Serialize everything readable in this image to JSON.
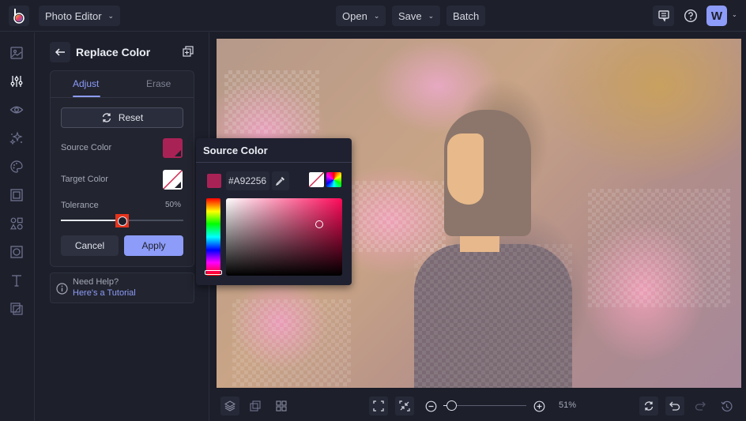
{
  "topbar": {
    "app_menu_label": "Photo Editor",
    "open_label": "Open",
    "save_label": "Save",
    "batch_label": "Batch",
    "avatar_initial": "W"
  },
  "rail": {
    "items": [
      {
        "name": "image",
        "active": false
      },
      {
        "name": "adjustments",
        "active": true
      },
      {
        "name": "eye",
        "active": false
      },
      {
        "name": "effects",
        "active": false
      },
      {
        "name": "artsy",
        "active": false
      },
      {
        "name": "frames",
        "active": false
      },
      {
        "name": "graphics",
        "active": false
      },
      {
        "name": "overlays",
        "active": false
      },
      {
        "name": "text",
        "active": false
      },
      {
        "name": "textures",
        "active": false
      }
    ]
  },
  "panel": {
    "title": "Replace Color",
    "tabs": [
      {
        "label": "Adjust",
        "active": true
      },
      {
        "label": "Erase",
        "active": false
      }
    ],
    "reset_label": "Reset",
    "source_color_label": "Source Color",
    "source_color_value": "#A92256",
    "target_color_label": "Target Color",
    "target_color_value": "none",
    "tolerance_label": "Tolerance",
    "tolerance_value": "50%",
    "tolerance_fraction": 0.5,
    "cancel_label": "Cancel",
    "apply_label": "Apply",
    "help_question": "Need Help?",
    "help_link": "Here's a Tutorial"
  },
  "color_popover": {
    "title": "Source Color",
    "hex_value": "#A92256",
    "swatch_color": "#A92256",
    "hue_fraction": 0.97,
    "saturation": 0.8,
    "brightness": 0.66
  },
  "bottombar": {
    "zoom_percent": "51%",
    "zoom_fraction": 0.1
  },
  "colors": {
    "accent": "#8d9cf8",
    "background": "#1d1f2b",
    "slider_highlight": "#e5331c"
  }
}
